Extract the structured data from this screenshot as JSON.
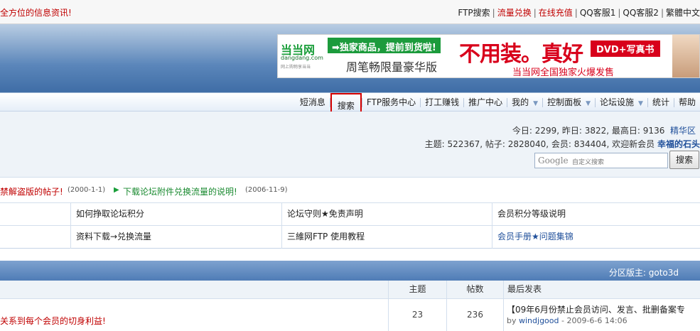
{
  "topbar": {
    "ticker": "全方位的信息资讯!",
    "links": [
      "FTP搜索",
      "流量兑换",
      "在线充值",
      "QQ客服1",
      "QQ客服2",
      "繁體中文"
    ]
  },
  "ad": {
    "logo_main": "当当网",
    "logo_url": "dangdang.com",
    "logo_tagline": "网上购物享当当",
    "promo": "➡独家商品，提前到货啦!",
    "product": "周笔畅限量豪华版",
    "slogan_big": "不用装。真好",
    "dvd": "DVD+写真书",
    "bottom": "当当网全国独家火爆发售"
  },
  "nav": {
    "items": [
      "短消息",
      "搜索",
      "FTP服务中心",
      "打工赚钱",
      "推广中心",
      "我的",
      "控制面板",
      "论坛设施",
      "统计",
      "帮助"
    ]
  },
  "stats": {
    "today_label": "今日: ",
    "today": "2299",
    "yesterday_label": ", 昨日: ",
    "yesterday": "3822",
    "max_label": ", 最高日: ",
    "max": "9136",
    "digest": "精华区",
    "topics_label": "主题: ",
    "topics": "522367",
    "posts_label": ", 帖子: ",
    "posts": "2828040",
    "members_label": ", 会员: ",
    "members": "834404",
    "welcome": ", 欢迎新会员 ",
    "newest_member": "幸福的石头"
  },
  "search": {
    "brand": "Google",
    "placeholder": "自定义搜索",
    "button": "搜索"
  },
  "announcements": [
    {
      "text": "禁解盗版的帖子!",
      "date": "(2000-1-1)"
    },
    {
      "text": "下载论坛附件兑换流量的说明!",
      "date": "(2006-11-9)"
    }
  ],
  "quicklinks": {
    "row1": [
      "如何挣取论坛积分",
      "论坛守则★免责声明",
      "会员积分等级说明"
    ],
    "row2": [
      "资料下载→兑换流量",
      "三維网FTP 使用教程",
      "会员手册★问题集锦"
    ]
  },
  "section": {
    "moderator": "分区版主: goto3d",
    "columns": [
      "主题",
      "帖数",
      "最后发表"
    ],
    "rows": [
      {
        "title": "关系到每个会员的切身利益!",
        "topics": "23",
        "posts": "236",
        "last_title": "【09年6月份禁止会员访问、发言、批删备案专",
        "last_by": "by ",
        "last_user": "windjgood",
        "last_time": " - 2009-6-6 14:06"
      }
    ]
  }
}
